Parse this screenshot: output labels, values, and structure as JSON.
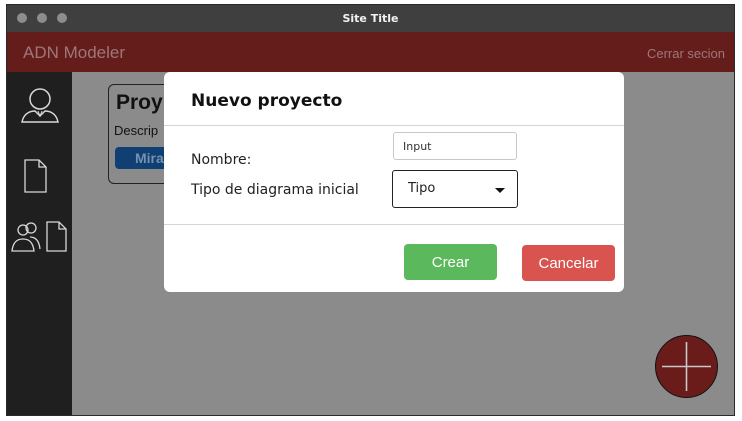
{
  "window": {
    "title": "Site Title"
  },
  "header": {
    "brand": "ADN Modeler",
    "logout_label": "Cerrar secion"
  },
  "sidebar": {
    "items": [
      {
        "icon": "user-icon"
      },
      {
        "icon": "document-icon"
      },
      {
        "icon": "shared-document-icon"
      }
    ]
  },
  "card": {
    "title": "Proy",
    "description": "Descrip",
    "button_label": "Mira"
  },
  "fab": {
    "icon": "plus-icon"
  },
  "modal": {
    "title": "Nuevo proyecto",
    "name_label": "Nombre:",
    "name_placeholder": "Input",
    "diagram_label": "Tipo de diagrama inicial",
    "diagram_value": "Tipo",
    "create_label": "Crear",
    "cancel_label": "Cancelar"
  },
  "colors": {
    "appbar": "#651d1c",
    "sidebar": "#1f1f1f",
    "create": "#5cb85c",
    "cancel": "#d9534f",
    "card_button": "#0f3f73"
  }
}
